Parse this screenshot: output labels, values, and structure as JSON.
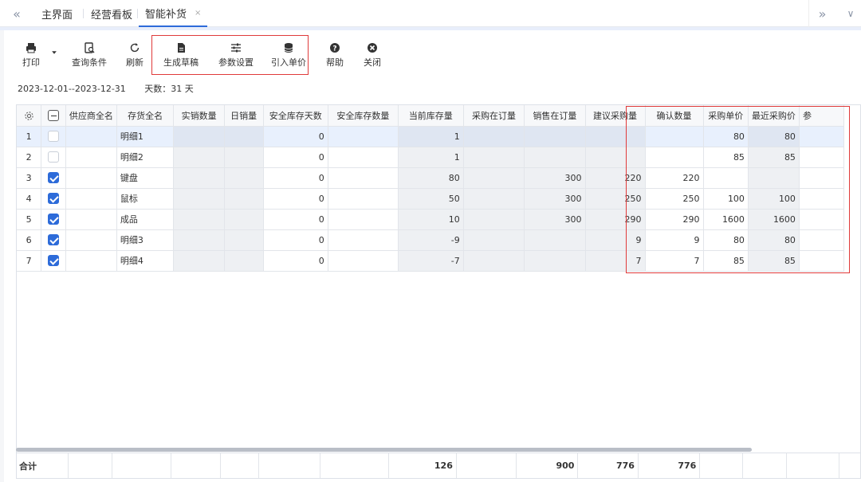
{
  "tabs": {
    "prev": "«",
    "items": [
      {
        "label": "主界面"
      },
      {
        "label": "经营看板"
      },
      {
        "label": "智能补货",
        "close": "×"
      }
    ],
    "next": "»",
    "more": "∨"
  },
  "toolbar": {
    "print": "打印",
    "query": "查询条件",
    "refresh": "刷新",
    "draft": "生成草稿",
    "params": "参数设置",
    "import_price": "引入单价",
    "help": "帮助",
    "close": "关闭"
  },
  "daterange": {
    "range": "2023-12-01--2023-12-31",
    "days": "天数：31 天"
  },
  "table": {
    "columns": [
      "供应商全名",
      "存货全名",
      "实销数量",
      "日销量",
      "安全库存天数",
      "安全库存数量",
      "当前库存量",
      "采购在订量",
      "销售在订量",
      "建议采购量",
      "确认数量",
      "采购单价",
      "最近采购价",
      "参"
    ],
    "rows": [
      {
        "no": "1",
        "checked": false,
        "supplier": "",
        "name": "明细1",
        "sold": "",
        "daily": "",
        "safe_days": "0",
        "safe_qty": "",
        "stock": "1",
        "po": "",
        "so": "",
        "suggest": "",
        "confirm": "",
        "price": "80",
        "last_price": "80"
      },
      {
        "no": "2",
        "checked": false,
        "supplier": "",
        "name": "明细2",
        "sold": "",
        "daily": "",
        "safe_days": "0",
        "safe_qty": "",
        "stock": "1",
        "po": "",
        "so": "",
        "suggest": "",
        "confirm": "",
        "price": "85",
        "last_price": "85"
      },
      {
        "no": "3",
        "checked": true,
        "supplier": "",
        "name": "键盘",
        "sold": "",
        "daily": "",
        "safe_days": "0",
        "safe_qty": "",
        "stock": "80",
        "po": "",
        "so": "300",
        "suggest": "220",
        "confirm": "220",
        "price": "",
        "last_price": ""
      },
      {
        "no": "4",
        "checked": true,
        "supplier": "",
        "name": "鼠标",
        "sold": "",
        "daily": "",
        "safe_days": "0",
        "safe_qty": "",
        "stock": "50",
        "po": "",
        "so": "300",
        "suggest": "250",
        "confirm": "250",
        "price": "100",
        "last_price": "100"
      },
      {
        "no": "5",
        "checked": true,
        "supplier": "",
        "name": "成品",
        "sold": "",
        "daily": "",
        "safe_days": "0",
        "safe_qty": "",
        "stock": "10",
        "po": "",
        "so": "300",
        "suggest": "290",
        "confirm": "290",
        "price": "1600",
        "last_price": "1600"
      },
      {
        "no": "6",
        "checked": true,
        "supplier": "",
        "name": "明细3",
        "sold": "",
        "daily": "",
        "safe_days": "0",
        "safe_qty": "",
        "stock": "-9",
        "po": "",
        "so": "",
        "suggest": "9",
        "confirm": "9",
        "price": "80",
        "last_price": "80"
      },
      {
        "no": "7",
        "checked": true,
        "supplier": "",
        "name": "明细4",
        "sold": "",
        "daily": "",
        "safe_days": "0",
        "safe_qty": "",
        "stock": "-7",
        "po": "",
        "so": "",
        "suggest": "7",
        "confirm": "7",
        "price": "85",
        "last_price": "85"
      }
    ],
    "footer": {
      "label": "合计",
      "stock": "126",
      "so": "900",
      "suggest": "776",
      "confirm": "776"
    }
  },
  "colors": {
    "accent": "#2d6bd9",
    "highlight": "#e03a3a"
  }
}
